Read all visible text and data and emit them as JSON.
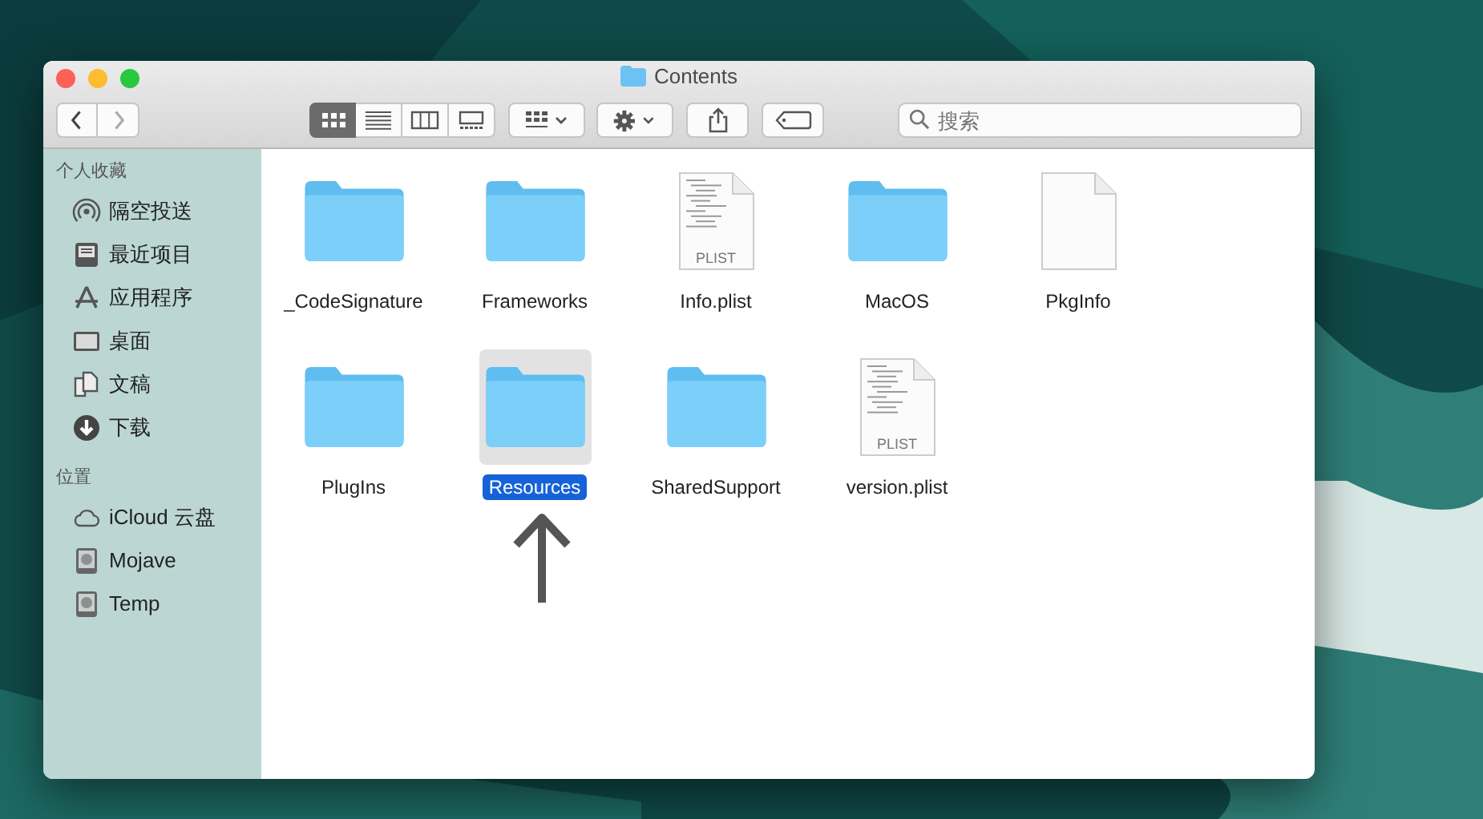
{
  "window": {
    "title": "Contents"
  },
  "toolbar": {
    "view_modes": [
      {
        "kind": "icons",
        "selected": true
      },
      {
        "kind": "list",
        "selected": false
      },
      {
        "kind": "columns",
        "selected": false
      },
      {
        "kind": "gallery",
        "selected": false
      }
    ],
    "search": {
      "placeholder": "搜索"
    }
  },
  "sidebar": {
    "sections": [
      {
        "heading": "个人收藏",
        "items": [
          {
            "label": "隔空投送",
            "kind": "airdrop"
          },
          {
            "label": "最近项目",
            "kind": "recents"
          },
          {
            "label": "应用程序",
            "kind": "apps"
          },
          {
            "label": "桌面",
            "kind": "desktop"
          },
          {
            "label": "文稿",
            "kind": "docs"
          },
          {
            "label": "下载",
            "kind": "download"
          }
        ]
      },
      {
        "heading": "位置",
        "items": [
          {
            "label": "iCloud 云盘",
            "kind": "cloud"
          },
          {
            "label": "Mojave",
            "kind": "disk"
          },
          {
            "label": "Temp",
            "kind": "disk"
          }
        ]
      }
    ]
  },
  "files": [
    {
      "name": "_CodeSignature",
      "kind": "folder",
      "selected": false
    },
    {
      "name": "Frameworks",
      "kind": "folder",
      "selected": false
    },
    {
      "name": "Info.plist",
      "kind": "plist",
      "badge": "PLIST",
      "selected": false
    },
    {
      "name": "MacOS",
      "kind": "folder",
      "selected": false
    },
    {
      "name": "PkgInfo",
      "kind": "blank",
      "selected": false
    },
    {
      "name": "PlugIns",
      "kind": "folder",
      "selected": false
    },
    {
      "name": "Resources",
      "kind": "folder",
      "selected": true
    },
    {
      "name": "SharedSupport",
      "kind": "folder",
      "selected": false
    },
    {
      "name": "version.plist",
      "kind": "plist",
      "badge": "PLIST",
      "selected": false
    }
  ]
}
